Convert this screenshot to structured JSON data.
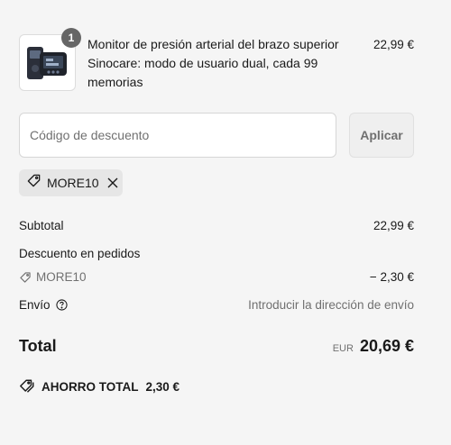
{
  "product": {
    "quantity": "1",
    "name": "Monitor de presión arterial del brazo superior Sinocare: modo de usuario dual, cada 99 memorias",
    "price": "22,99 €"
  },
  "discount": {
    "placeholder": "Código de descuento",
    "apply_label": "Aplicar",
    "applied_code": "MORE10"
  },
  "summary": {
    "subtotal_label": "Subtotal",
    "subtotal_value": "22,99 €",
    "order_discount_label": "Descuento en pedidos",
    "order_discount_code": "MORE10",
    "order_discount_value": "− 2,30 €",
    "shipping_label": "Envío",
    "shipping_value": "Introducir la dirección de envío",
    "total_label": "Total",
    "total_currency": "EUR",
    "total_value": "20,69 €"
  },
  "savings": {
    "label": "AHORRO TOTAL",
    "value": "2,30 €"
  },
  "icons": {
    "tag": "tag-icon",
    "close": "close-icon",
    "help": "question-circle-icon",
    "savings_tags": "tags-icon"
  },
  "colors": {
    "background": "#f5f5f5",
    "text": "#1a1a1a",
    "muted": "#707070",
    "badge": "#666666"
  }
}
